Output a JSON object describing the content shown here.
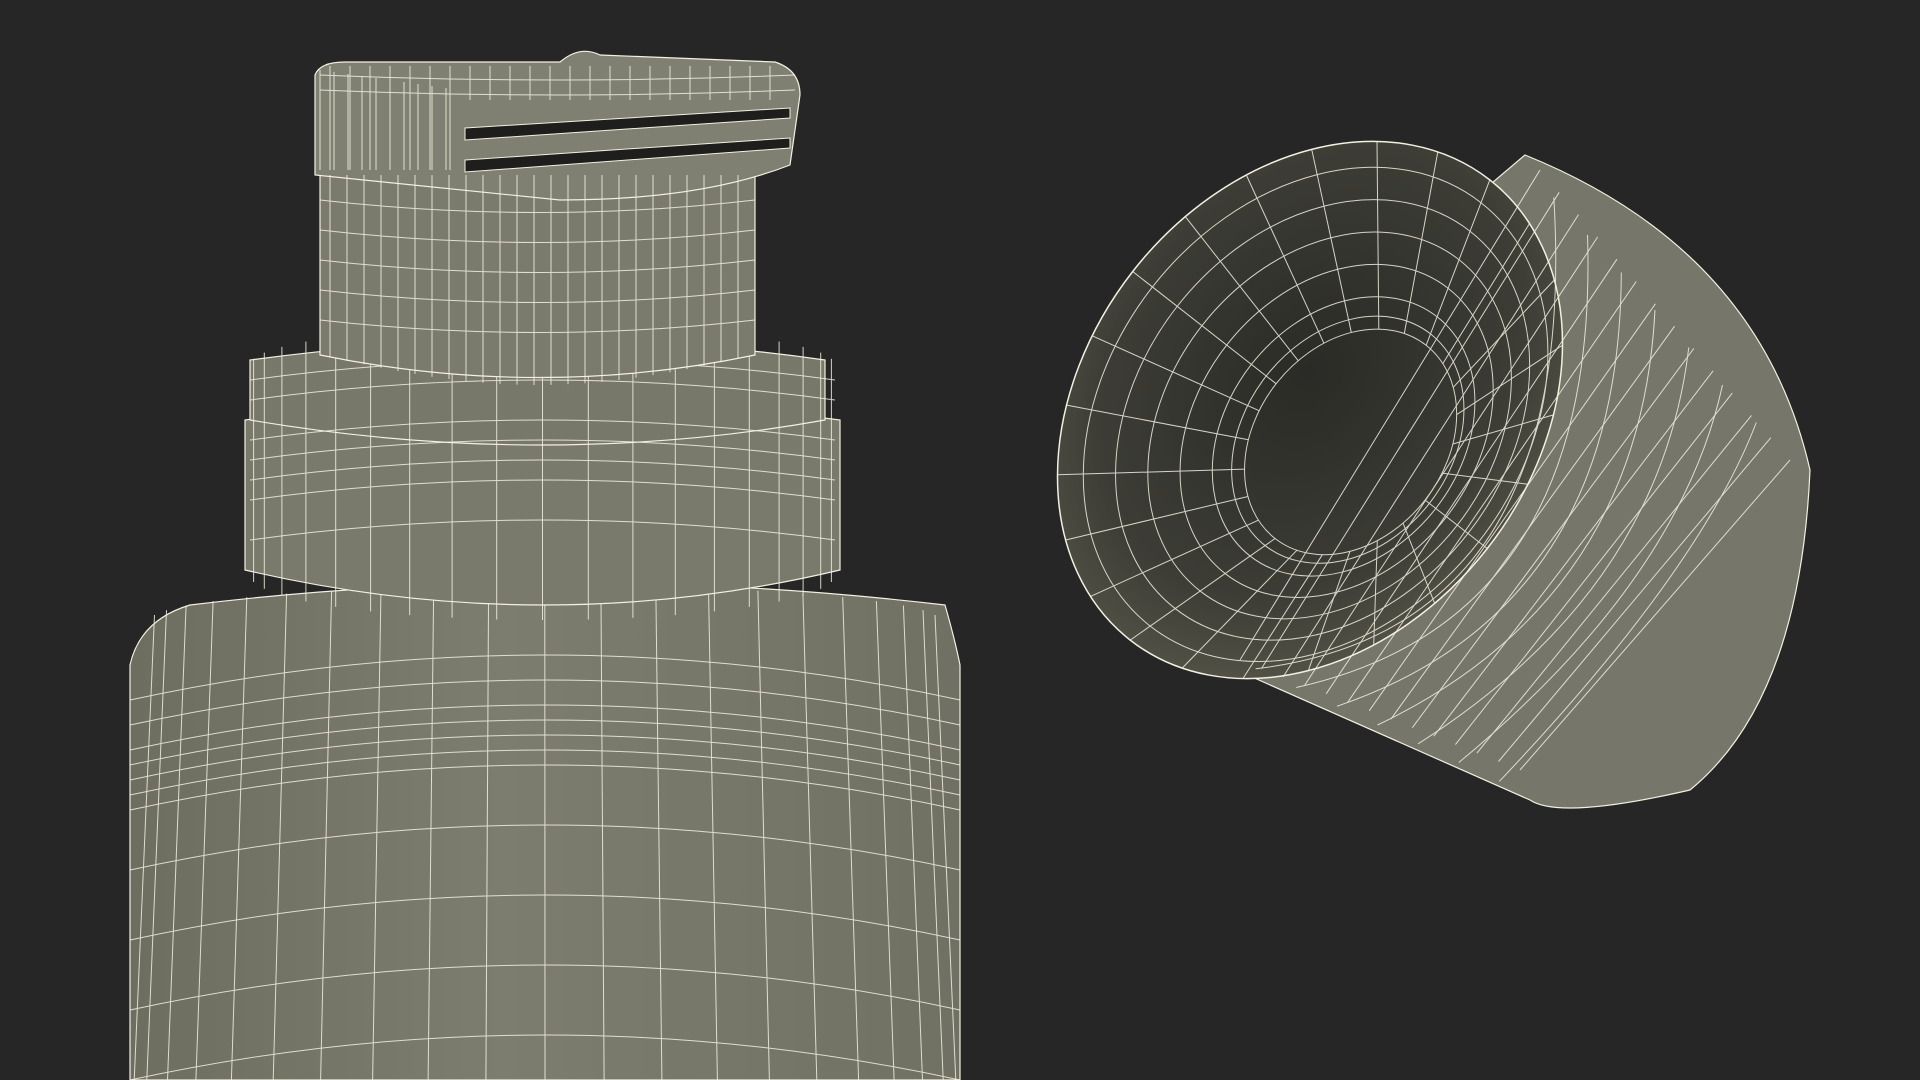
{
  "scene": {
    "background_color": "#262626",
    "model_color": "#7a7a6c",
    "model_color_shade": "#66665a",
    "inner_color": "#3a3a33",
    "wire_color": "#f2f0e0",
    "objects": [
      {
        "name": "bottle-body",
        "icon": "bottle-icon"
      },
      {
        "name": "bottle-neck-ring",
        "icon": "ring-icon"
      },
      {
        "name": "flip-top-dispenser",
        "icon": "cap-icon"
      },
      {
        "name": "bottle-cap-open",
        "icon": "cap-icon"
      }
    ]
  }
}
